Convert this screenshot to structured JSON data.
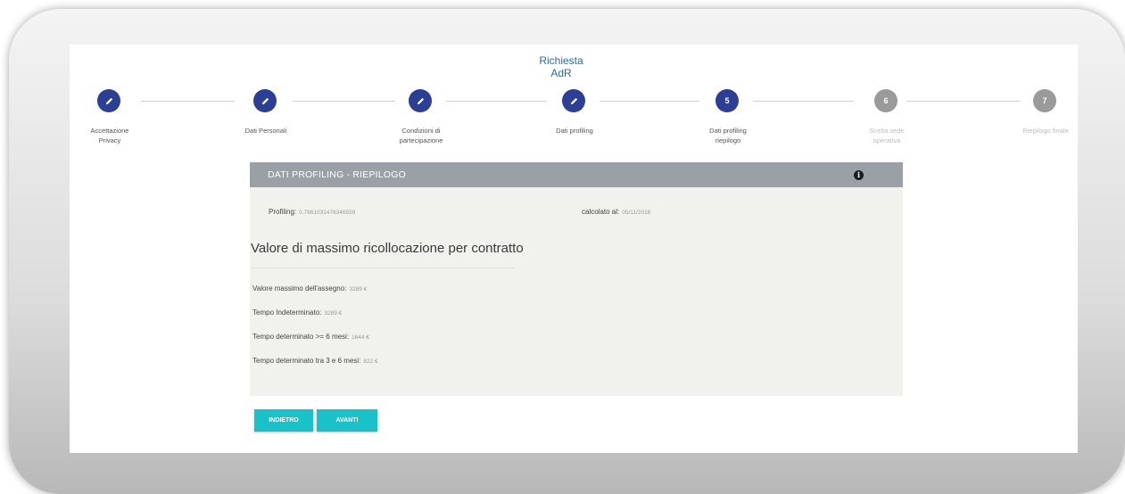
{
  "header": {
    "title": "Richiesta AdR"
  },
  "steps": [
    {
      "number": "",
      "label_line1": "Accettazione",
      "label_line2": "Privacy",
      "state": "done",
      "icon": "pencil-icon"
    },
    {
      "number": "",
      "label_line1": "Dati Personali",
      "label_line2": "",
      "state": "done",
      "icon": "pencil-icon"
    },
    {
      "number": "",
      "label_line1": "Condizioni di",
      "label_line2": "partecipazione",
      "state": "done",
      "icon": "pencil-icon"
    },
    {
      "number": "",
      "label_line1": "Dati profiling",
      "label_line2": "",
      "state": "done",
      "icon": "pencil-icon"
    },
    {
      "number": "5",
      "label_line1": "Dati profiling",
      "label_line2": "riepilogo",
      "state": "active",
      "icon": ""
    },
    {
      "number": "6",
      "label_line1": "Scelta sede",
      "label_line2": "operativa",
      "state": "todo",
      "icon": ""
    },
    {
      "number": "7",
      "label_line1": "Riepilogo finale",
      "label_line2": "",
      "state": "todo",
      "icon": ""
    }
  ],
  "panel": {
    "title": "DATI PROFILING - RIEPILOGO",
    "info_icon": "info-icon",
    "profiling_label": "Profiling:",
    "profiling_value": "0.7861031476346559",
    "calcolato_label": "calcolato al:",
    "calcolato_value": "05/11/2018",
    "section_title": "Valore di massimo ricollocazione per contratto",
    "rows": [
      {
        "label": "Valore massimo dell'assegno:",
        "value": "3289 €"
      },
      {
        "label": "Tempo Indeterminato:",
        "value": "3289 €"
      },
      {
        "label": "Tempo determinato >= 6 mesi:",
        "value": "1644 €"
      },
      {
        "label": "Tempo determinato tra 3 e 6 mesi:",
        "value": "822 €"
      }
    ]
  },
  "buttons": {
    "back": "INDIETRO",
    "next": "AVANTI"
  },
  "colors": {
    "step_done": "#2b3f96",
    "step_todo": "#9a9a9a",
    "panel_header": "#9aa0a6",
    "button": "#19c2c9",
    "title": "#2f6aa0"
  }
}
